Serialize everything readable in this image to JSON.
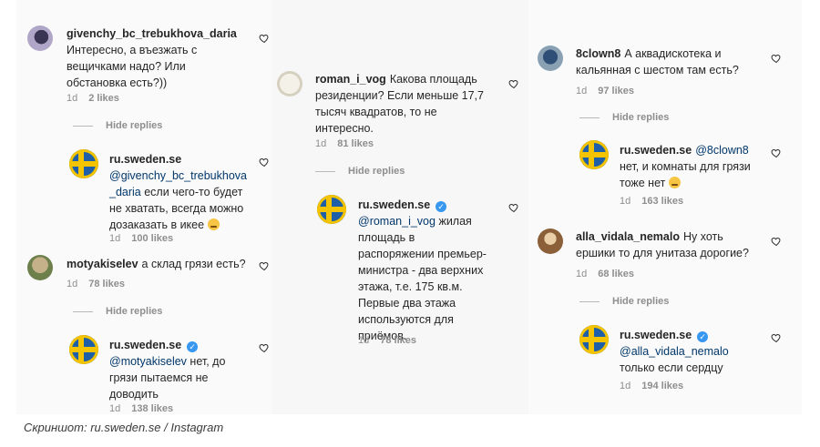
{
  "caption": "Скриншот: ru.sweden.se / Instagram",
  "icons": {
    "like": "heart-outline-icon",
    "verified": "verified-badge-icon"
  },
  "colors": {
    "mention": "#00376b",
    "verified": "#3897f0",
    "meta": "#8e8e8e",
    "flag_blue": "#1f5fa8",
    "flag_yellow": "#f5c400"
  },
  "panel1": {
    "c1": {
      "user": "givenchy_bc_trebukhova_daria",
      "l1": "Интересно, а въезжать с",
      "l2": "вещичками надо? Или",
      "l3": "обстановка есть?))",
      "time": "1d",
      "likes": "2 likes"
    },
    "hide1": "Hide replies",
    "r1": {
      "user": "ru.sweden.se",
      "m1": "@givenchy_bc_trebukhova",
      "m2": "_daria",
      "t1": "если чего-то будет",
      "t2": "не хватать, всегда можно",
      "t3": "дозаказать в икее",
      "time": "1d",
      "likes": "100 likes"
    },
    "c2": {
      "user": "motyakiselev",
      "l1": "а склад грязи есть?",
      "time": "1d",
      "likes": "78 likes"
    },
    "hide2": "Hide replies",
    "r2": {
      "user": "ru.sweden.se",
      "mention": "@motyakiselev",
      "t1": "нет, до",
      "t2": "грязи пытаемся не",
      "t3": "доводить",
      "time": "1d",
      "likes": "138 likes"
    }
  },
  "panel2": {
    "c1": {
      "user": "roman_i_vog",
      "l1": "Какова площадь",
      "l2": "резиденции? Если меньше 17,7",
      "l3": "тысяч квадратов, то не",
      "l4": "интересно.",
      "time": "1d",
      "likes": "81 likes"
    },
    "hide1": "Hide replies",
    "r1": {
      "user": "ru.sweden.se",
      "mention": "@roman_i_vog",
      "t1": "жилая",
      "t2": "площадь в",
      "t3": "распоряжении премьер-",
      "t4": "министра - два верхних",
      "t5": "этажа, т.е. 175 кв.м.",
      "t6": "Первые два этажа",
      "t7": "используются для",
      "t8": "приёмов.",
      "time": "1d",
      "likes": "78 likes"
    }
  },
  "panel3": {
    "c1": {
      "user": "8clown8",
      "l1": "А аквадискотека и",
      "l2": "кальянная с шестом там есть?",
      "time": "1d",
      "likes": "97 likes"
    },
    "hide1": "Hide replies",
    "r1": {
      "user": "ru.sweden.se",
      "mention": "@8clown8",
      "t1": "нет, и комнаты для грязи",
      "t2": "тоже нет",
      "time": "1d",
      "likes": "163 likes"
    },
    "c2": {
      "user": "alla_vidala_nemalo",
      "l1": "Ну хоть",
      "l2": "ершики то для унитаза дорогие?",
      "time": "1d",
      "likes": "68 likes"
    },
    "hide2": "Hide replies",
    "r2": {
      "user": "ru.sweden.se",
      "mention": "@alla_vidala_nemalo",
      "t1": "только если сердцу",
      "time": "1d",
      "likes": "194 likes"
    }
  }
}
